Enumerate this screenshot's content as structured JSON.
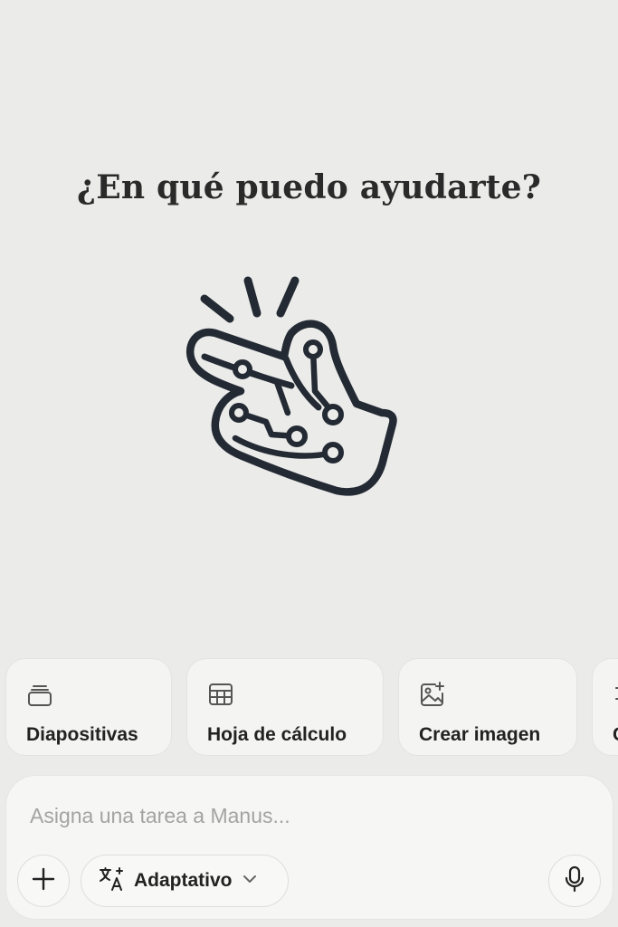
{
  "headline": "¿En qué puedo ayudarte?",
  "hero": {
    "icon": "snap-fingers-circuit-icon",
    "color": "#232a33"
  },
  "chips": [
    {
      "label": "Diapositivas",
      "icon": "slides-stack-icon"
    },
    {
      "label": "Hoja de cálculo",
      "icon": "spreadsheet-grid-icon"
    },
    {
      "label": "Crear imagen",
      "icon": "image-sparkle-icon"
    },
    {
      "label": "C",
      "icon": "more-tool-icon"
    }
  ],
  "composer": {
    "placeholder": "Asigna una tarea a Manus...",
    "value": "",
    "add_icon": "plus-icon",
    "mode_icon": "translate-sparkle-icon",
    "mode_label": "Adaptativo",
    "mode_chevron": "chevron-down-icon",
    "mic_icon": "microphone-icon"
  }
}
